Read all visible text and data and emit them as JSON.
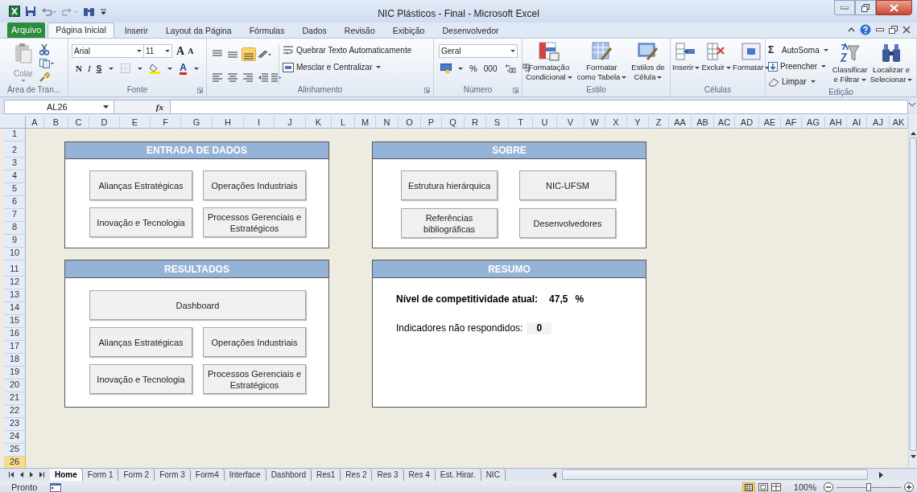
{
  "window": {
    "title": "NIC Plásticos - Final  -  Microsoft Excel"
  },
  "ribbon": {
    "file_tab": "Arquivo",
    "tabs": [
      {
        "label": "Página Inicial",
        "selected": true
      },
      {
        "label": "Inserir",
        "selected": false
      },
      {
        "label": "Layout da Página",
        "selected": false
      },
      {
        "label": "Fórmulas",
        "selected": false
      },
      {
        "label": "Dados",
        "selected": false
      },
      {
        "label": "Revisão",
        "selected": false
      },
      {
        "label": "Exibição",
        "selected": false
      },
      {
        "label": "Desenvolvedor",
        "selected": false
      }
    ],
    "groups": [
      {
        "kind": "clipboard",
        "label": "Área de Tran...",
        "paste": "Colar"
      },
      {
        "kind": "font",
        "label": "Fonte",
        "font_name": "Arial",
        "font_size": "11",
        "grow": "A",
        "shrink": "A",
        "styles": [
          "N",
          "I",
          "S"
        ],
        "color_glyph": "A"
      },
      {
        "kind": "alignment",
        "label": "Alinhamento",
        "wrap": "Quebrar Texto Automaticamente",
        "merge": "Mesclar e Centralizar"
      },
      {
        "kind": "number",
        "label": "Número",
        "format": "Geral",
        "percent": "%",
        "thousands": "000"
      },
      {
        "kind": "style",
        "label": "Estilo",
        "buttons": [
          [
            "Formatação",
            "Condicional"
          ],
          [
            "Formatar",
            "como Tabela"
          ],
          [
            "Estilos de",
            "Célula"
          ]
        ]
      },
      {
        "kind": "cells",
        "label": "Células",
        "buttons": [
          "Inserir",
          "Excluir",
          "Formatar"
        ]
      },
      {
        "kind": "editing",
        "label": "Edição",
        "sigma": "Σ",
        "items": [
          "AutoSoma",
          "Preencher",
          "Limpar"
        ],
        "buttons": [
          [
            "Classificar",
            "e Filtrar"
          ],
          [
            "Localizar e",
            "Selecionar"
          ]
        ]
      }
    ]
  },
  "formula_bar": {
    "name_box": "AL26",
    "function_label": "fx"
  },
  "sheet": {
    "columns": [
      "A",
      "B",
      "C",
      "D",
      "E",
      "F",
      "G",
      "H",
      "I",
      "J",
      "K",
      "L",
      "M",
      "N",
      "O",
      "P",
      "Q",
      "R",
      "S",
      "T",
      "U",
      "V",
      "W",
      "X",
      "Y",
      "Z",
      "AA",
      "AB",
      "AC",
      "AD",
      "AE",
      "AF",
      "AG",
      "AH",
      "AI",
      "AJ",
      "AK"
    ],
    "rows": [
      {
        "label": "1",
        "selected": false
      },
      {
        "label": "2",
        "selected": false
      },
      {
        "label": "3",
        "selected": false
      },
      {
        "label": "4",
        "selected": false
      },
      {
        "label": "5",
        "selected": false
      },
      {
        "label": "6",
        "selected": false
      },
      {
        "label": "7",
        "selected": false
      },
      {
        "label": "8",
        "selected": false
      },
      {
        "label": "9",
        "selected": false
      },
      {
        "label": "10",
        "selected": false
      },
      {
        "label": "11",
        "selected": false
      },
      {
        "label": "12",
        "selected": false
      },
      {
        "label": "13",
        "selected": false
      },
      {
        "label": "14",
        "selected": false
      },
      {
        "label": "15",
        "selected": false
      },
      {
        "label": "16",
        "selected": false
      },
      {
        "label": "17",
        "selected": false
      },
      {
        "label": "18",
        "selected": false
      },
      {
        "label": "19",
        "selected": false
      },
      {
        "label": "20",
        "selected": false
      },
      {
        "label": "21",
        "selected": false
      },
      {
        "label": "22",
        "selected": false
      },
      {
        "label": "23",
        "selected": false
      },
      {
        "label": "24",
        "selected": false
      },
      {
        "label": "25",
        "selected": false
      },
      {
        "label": "26",
        "selected": true
      }
    ],
    "panels": [
      {
        "kind": "buttons",
        "title": "ENTRADA DE DADOS",
        "button_rows": [
          [
            "Alianças Estratégicas",
            "Operações Industriais"
          ],
          [
            "Inovação e Tecnologia",
            "Processos Gerenciais e Estratégicos"
          ]
        ]
      },
      {
        "kind": "buttons",
        "title": "SOBRE",
        "button_rows": [
          [
            "Estrutura hierárquica",
            "NIC-UFSM"
          ],
          [
            "Referências bibliográficas",
            "Desenvolvedores"
          ]
        ]
      },
      {
        "kind": "buttons",
        "title": "RESULTADOS",
        "button_rows": [
          [
            "Dashboard"
          ],
          [
            "Alianças Estratégicas",
            "Operações Industriais"
          ],
          [
            "Inovação e Tecnologia",
            "Processos Gerenciais e Estratégicos"
          ]
        ]
      },
      {
        "kind": "summary",
        "title": "RESUMO",
        "competitiveness_label": "Nível de competitividade atual:",
        "competitiveness_value": "47,5",
        "competitiveness_unit": "%",
        "unanswered_label": "Indicadores não respondidos:",
        "unanswered_value": "0"
      }
    ]
  },
  "sheet_tabs": [
    {
      "label": "Home",
      "selected": true
    },
    {
      "label": "Form 1",
      "selected": false
    },
    {
      "label": "Form 2",
      "selected": false
    },
    {
      "label": "Form 3",
      "selected": false
    },
    {
      "label": "Form4",
      "selected": false
    },
    {
      "label": "Interface",
      "selected": false
    },
    {
      "label": "Dashbord",
      "selected": false
    },
    {
      "label": "Res1",
      "selected": false
    },
    {
      "label": "Res 2",
      "selected": false
    },
    {
      "label": "Res 3",
      "selected": false
    },
    {
      "label": "Res 4",
      "selected": false
    },
    {
      "label": "Est. Hirar.",
      "selected": false
    },
    {
      "label": "NIC",
      "selected": false
    }
  ],
  "status_bar": {
    "status": "Pronto",
    "zoom": "100%",
    "zoom_slider": {
      "level": 0.5
    }
  }
}
